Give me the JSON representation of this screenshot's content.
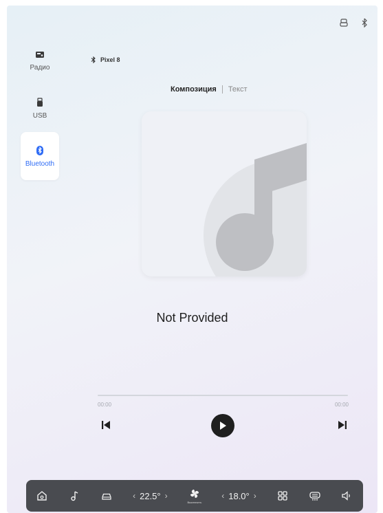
{
  "sidebar": {
    "items": [
      {
        "label": "Радио",
        "icon": "radio-icon"
      },
      {
        "label": "USB",
        "icon": "usb-icon"
      },
      {
        "label": "Bluetooth",
        "icon": "bluetooth-icon",
        "active": true
      }
    ]
  },
  "device": {
    "name": "Pixel 8",
    "icon": "bluetooth-icon"
  },
  "tabs": [
    {
      "label": "Композиция",
      "active": true
    },
    {
      "label": "Текст",
      "active": false
    }
  ],
  "track": {
    "title": "Not Provided"
  },
  "playback": {
    "elapsed": "00:00",
    "total": "00:00",
    "progress": 0,
    "state": "paused"
  },
  "climate": {
    "left_temp": "22.5°",
    "right_temp": "18.0°",
    "fan_label": "Выключить"
  },
  "dock_icons": [
    "home-icon",
    "music-icon",
    "car-icon",
    "fan-icon",
    "apps-icon",
    "rear-defrost-icon",
    "volume-icon"
  ],
  "colors": {
    "accent": "#2f6cf5",
    "dock_bg": "#494b50",
    "play_button": "#1f1f1f"
  }
}
